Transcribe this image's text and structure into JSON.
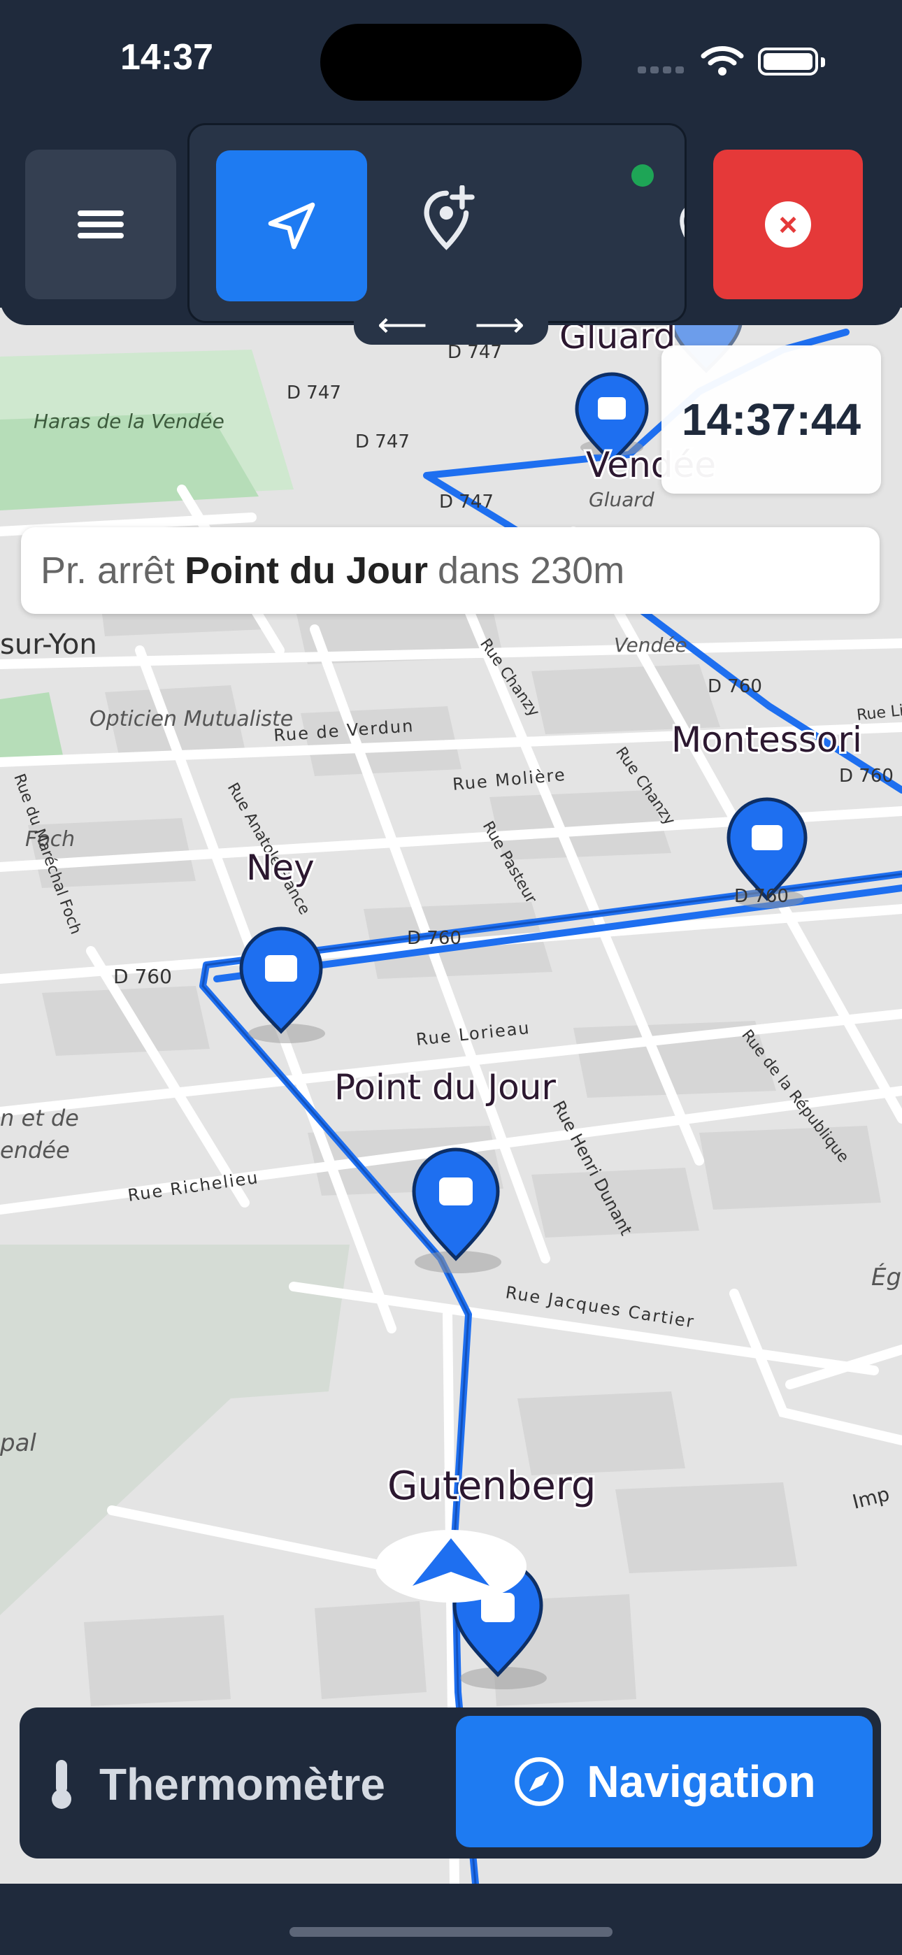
{
  "status_bar": {
    "time": "14:37"
  },
  "toolbar": {
    "menu_icon": "hamburger-icon",
    "navigate_icon": "navigation-arrow-icon",
    "add_location_icon": "location-add-icon",
    "phone_icon": "phone-icon",
    "close_icon": "close-icon",
    "scroll_left_icon": "arrow-left-icon",
    "scroll_right_icon": "arrow-right-icon",
    "left_arrow": "⟵",
    "right_arrow": "⟶"
  },
  "clock": {
    "value": "14:37:44"
  },
  "next_stop_banner": {
    "prefix": "Pr. arrêt",
    "stop_name": "Point du Jour",
    "suffix": "dans 230m"
  },
  "map": {
    "stops": [
      {
        "name": "Gluard"
      },
      {
        "name": "Vendée"
      },
      {
        "name": "Montessori"
      },
      {
        "name": "Ney"
      },
      {
        "name": "Point du Jour"
      },
      {
        "name": "Gutenberg"
      }
    ],
    "labels": {
      "d747_a": "D 747",
      "d747_b": "D 747",
      "d747_c": "D 747",
      "d747_d": "D 747",
      "d760_a": "D 760",
      "d760_b": "D 760",
      "d760_c": "D 760",
      "d760_d": "D 760",
      "d760_e": "D 760",
      "haras": "Haras de la Vendée",
      "gluard_small": "Gluard",
      "vendee_small": "Vendée",
      "sur_yon": "sur-Yon",
      "opticien": "Opticien Mutualiste",
      "foch": "Foch",
      "rue_verdun": "Rue de Verdun",
      "rue_moliere": "Rue Molière",
      "rue_chanzy": "Rue Chanzy",
      "rue_chanzy2": "Rue Chanzy",
      "rue_pasteur": "Rue Pasteur",
      "rue_anatole": "Rue Anatole France",
      "rue_lorieau": "Rue Lorieau",
      "rue_republique": "Rue de la République",
      "rue_henri": "Rue Henri Dunant",
      "rue_richelieu": "Rue Richelieu",
      "rue_jacques": "Rue Jacques Cartier",
      "rue_litt": "Rue Litt",
      "marechal": "Rue du Maréchal Foch",
      "ent_vendee": "n et de\nendée",
      "egl": "Égl",
      "pal": "pal",
      "imp": "Imp"
    },
    "route_color": "#1e6ff0",
    "stop_icon": "bus-stop-icon",
    "vehicle_icon": "vehicle-position-icon"
  },
  "bottom_nav": {
    "thermometer_label": "Thermomètre",
    "thermometer_icon": "thermometer-icon",
    "navigation_label": "Navigation",
    "navigation_icon": "compass-icon"
  },
  "colors": {
    "bar_bg": "#1f2a3c",
    "accent": "#1e7bf2",
    "danger": "#e53939",
    "online": "#1ea556"
  }
}
